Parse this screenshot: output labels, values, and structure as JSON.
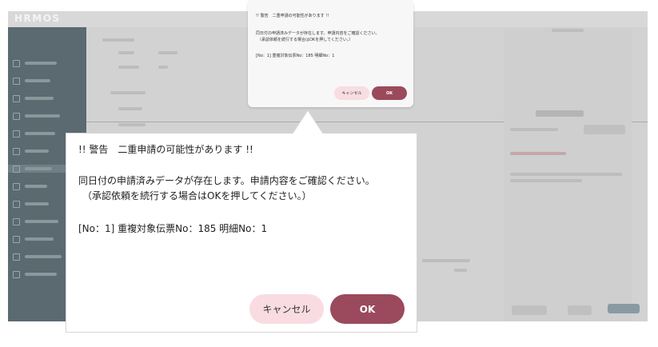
{
  "background_app": {
    "logo": "HRMOS",
    "colors": {
      "sidebar": "#5a6a70",
      "overlay": "#c9c9c9"
    }
  },
  "small_dialog": {
    "title": "!! 警告　二重申請の可能性があります !!",
    "line1": "同日付の申請済みデータが存在します。申請内容をご確認ください。",
    "line2": "（承認依頼を続行する場合はOKを押してください。）",
    "line3": "[No：1] 重複対象伝票No：185 明細No：1",
    "cancel_label": "キャンセル",
    "ok_label": "OK"
  },
  "zoom_dialog": {
    "title": "!! 警告　二重申請の可能性があります !!",
    "line1": "同日付の申請済みデータが存在します。申請内容をご確認ください。",
    "line2": "（承認依頼を続行する場合はOKを押してください。）",
    "line3": "[No：1] 重複対象伝票No：185 明細No：1",
    "cancel_label": "キャンセル",
    "ok_label": "OK"
  },
  "colors": {
    "ok_button": "#9a4a5c",
    "cancel_button": "#f9dce2"
  }
}
